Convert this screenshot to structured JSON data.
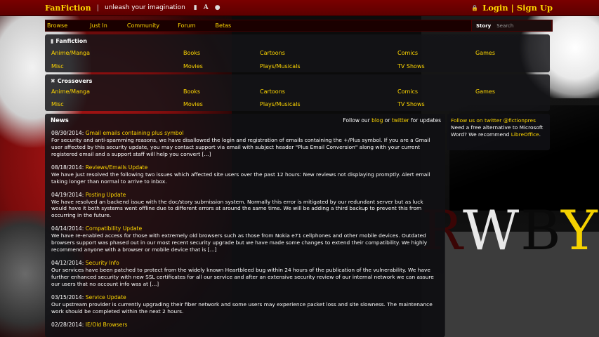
{
  "header": {
    "brand": "FanFiction",
    "separator": "|",
    "tagline": "unleash your imagination",
    "icons": [
      "mobile-icon",
      "font-icon",
      "globe-icon"
    ],
    "login": "Login",
    "pipe": "|",
    "signup": "Sign Up",
    "accent_color": "#ffd700",
    "bar_color": "#7a0000"
  },
  "nav": {
    "items": [
      "Browse",
      "Just In",
      "Community",
      "Forum",
      "Betas"
    ],
    "search_scope": "Story",
    "search_placeholder": "Search"
  },
  "fanfiction": {
    "title": "Fanfiction",
    "row1": [
      "Anime/Manga",
      "Books",
      "Cartoons",
      "Comics",
      "Games"
    ],
    "row2": [
      "Misc",
      "Movies",
      "Plays/Musicals",
      "TV Shows"
    ]
  },
  "crossovers": {
    "title": "Crossovers",
    "row1": [
      "Anime/Manga",
      "Books",
      "Cartoons",
      "Comics",
      "Games"
    ],
    "row2": [
      "Misc",
      "Movies",
      "Plays/Musicals",
      "TV Shows"
    ]
  },
  "news": {
    "title": "News",
    "follow_prefix": "Follow our",
    "blog": "blog",
    "or": "or",
    "twitter": "twitter",
    "follow_suffix": "for updates",
    "items": [
      {
        "date": "08/30/2014:",
        "title": "Gmail emails containing plus symbol",
        "body": "For security and anti-spamming reasons, we have disallowed the login and registration of emails containing the +/Plus symbol. If you are a Gmail user affected by this security update, you may contact support via email with subject header \"Plus Email Conversion\" along with your current registered email and a support staff will help you convert [...]"
      },
      {
        "date": "08/18/2014:",
        "title": "Reviews/Emails Update",
        "body": "We have just resolved the following two issues which affected site users over the past 12 hours: New reviews not displaying promptly. Alert email taking longer than normal to arrive to inbox."
      },
      {
        "date": "04/19/2014:",
        "title": "Posting Update",
        "body": "We have resolved an backend issue with the doc/story submission system. Normally this error is mitigated by our redundant server but as luck would have it both systems went offline due to different errors at around the same time. We will be adding a third backup to prevent this from occurring in the future."
      },
      {
        "date": "04/14/2014:",
        "title": "Compatibility Update",
        "body": "We have re-enabled access for those with extremely old browsers such as those from Nokia e71 cellphones and other mobile devices. Outdated browsers support was phased out  in our most recent security upgrade but we have made some changes to extend their compatibility. We highly recommend anyone with a browser or mobile device that is [...]"
      },
      {
        "date": "04/12/2014:",
        "title": "Security Info",
        "body": "Our services have been patched to protect from the widely known Heartbleed bug within 24 hours of the publication of the vulnerability. We have further enhanced security with new SSL certificates for all our service and after an extensive security review of our internal network we can assure our users that no account info was at [...]"
      },
      {
        "date": "03/15/2014:",
        "title": "Service Update",
        "body": "Our upstream provider is currently upgrading their fiber network and some users may experience packet loss and site slowness. The maintenance work should be completed within the next 2 hours."
      },
      {
        "date": "02/28/2014:",
        "title": "IE/Old Browsers",
        "body": ""
      }
    ]
  },
  "sidebar": {
    "twitter_follow": "Follow us on twitter @fictionpres",
    "text": "Need a free alternative to Microsoft Word? We recommend",
    "libreoffice": "LibreOffice",
    "period": "."
  },
  "background": {
    "logo_letters": [
      "R",
      "W",
      "B",
      "Y"
    ]
  }
}
